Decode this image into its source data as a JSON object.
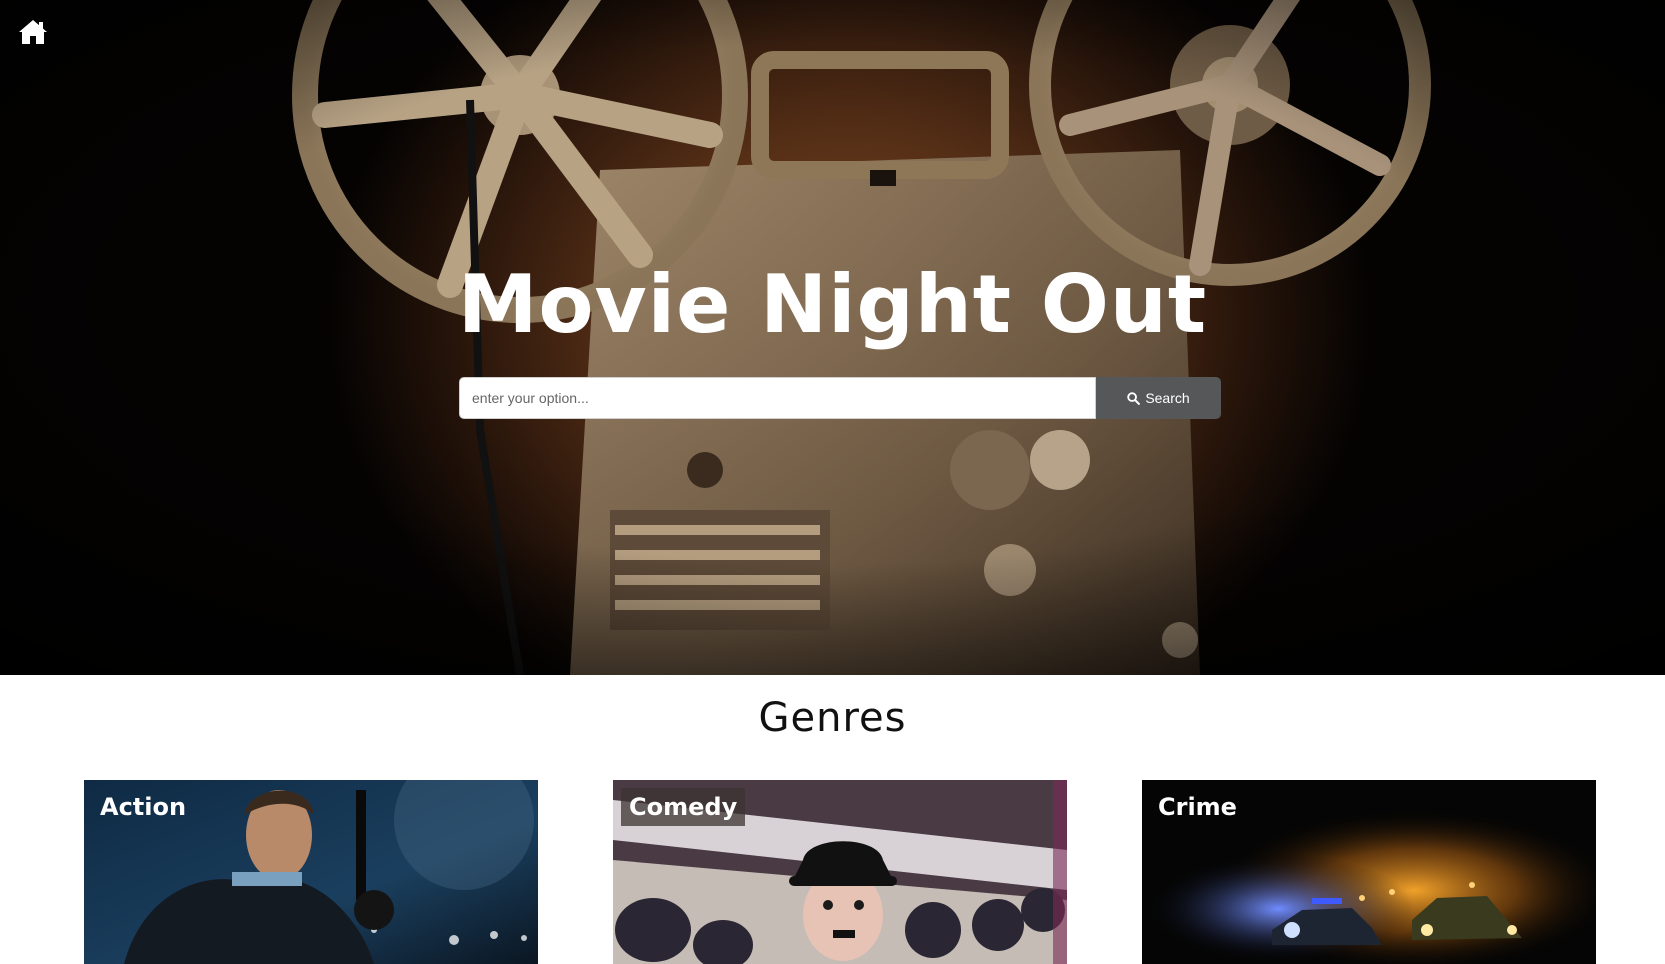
{
  "nav": {
    "home_icon": "home-icon"
  },
  "hero": {
    "title": "Movie Night Out",
    "search": {
      "placeholder": "enter your option...",
      "value": "",
      "button_label": "Search",
      "button_icon": "search-icon"
    }
  },
  "genres": {
    "heading": "Genres",
    "cards": [
      {
        "label": "Action"
      },
      {
        "label": "Comedy"
      },
      {
        "label": "Crime"
      }
    ]
  },
  "colors": {
    "search_button": "#555759",
    "hero_warm": "#844e28",
    "text_light": "#ffffff"
  }
}
